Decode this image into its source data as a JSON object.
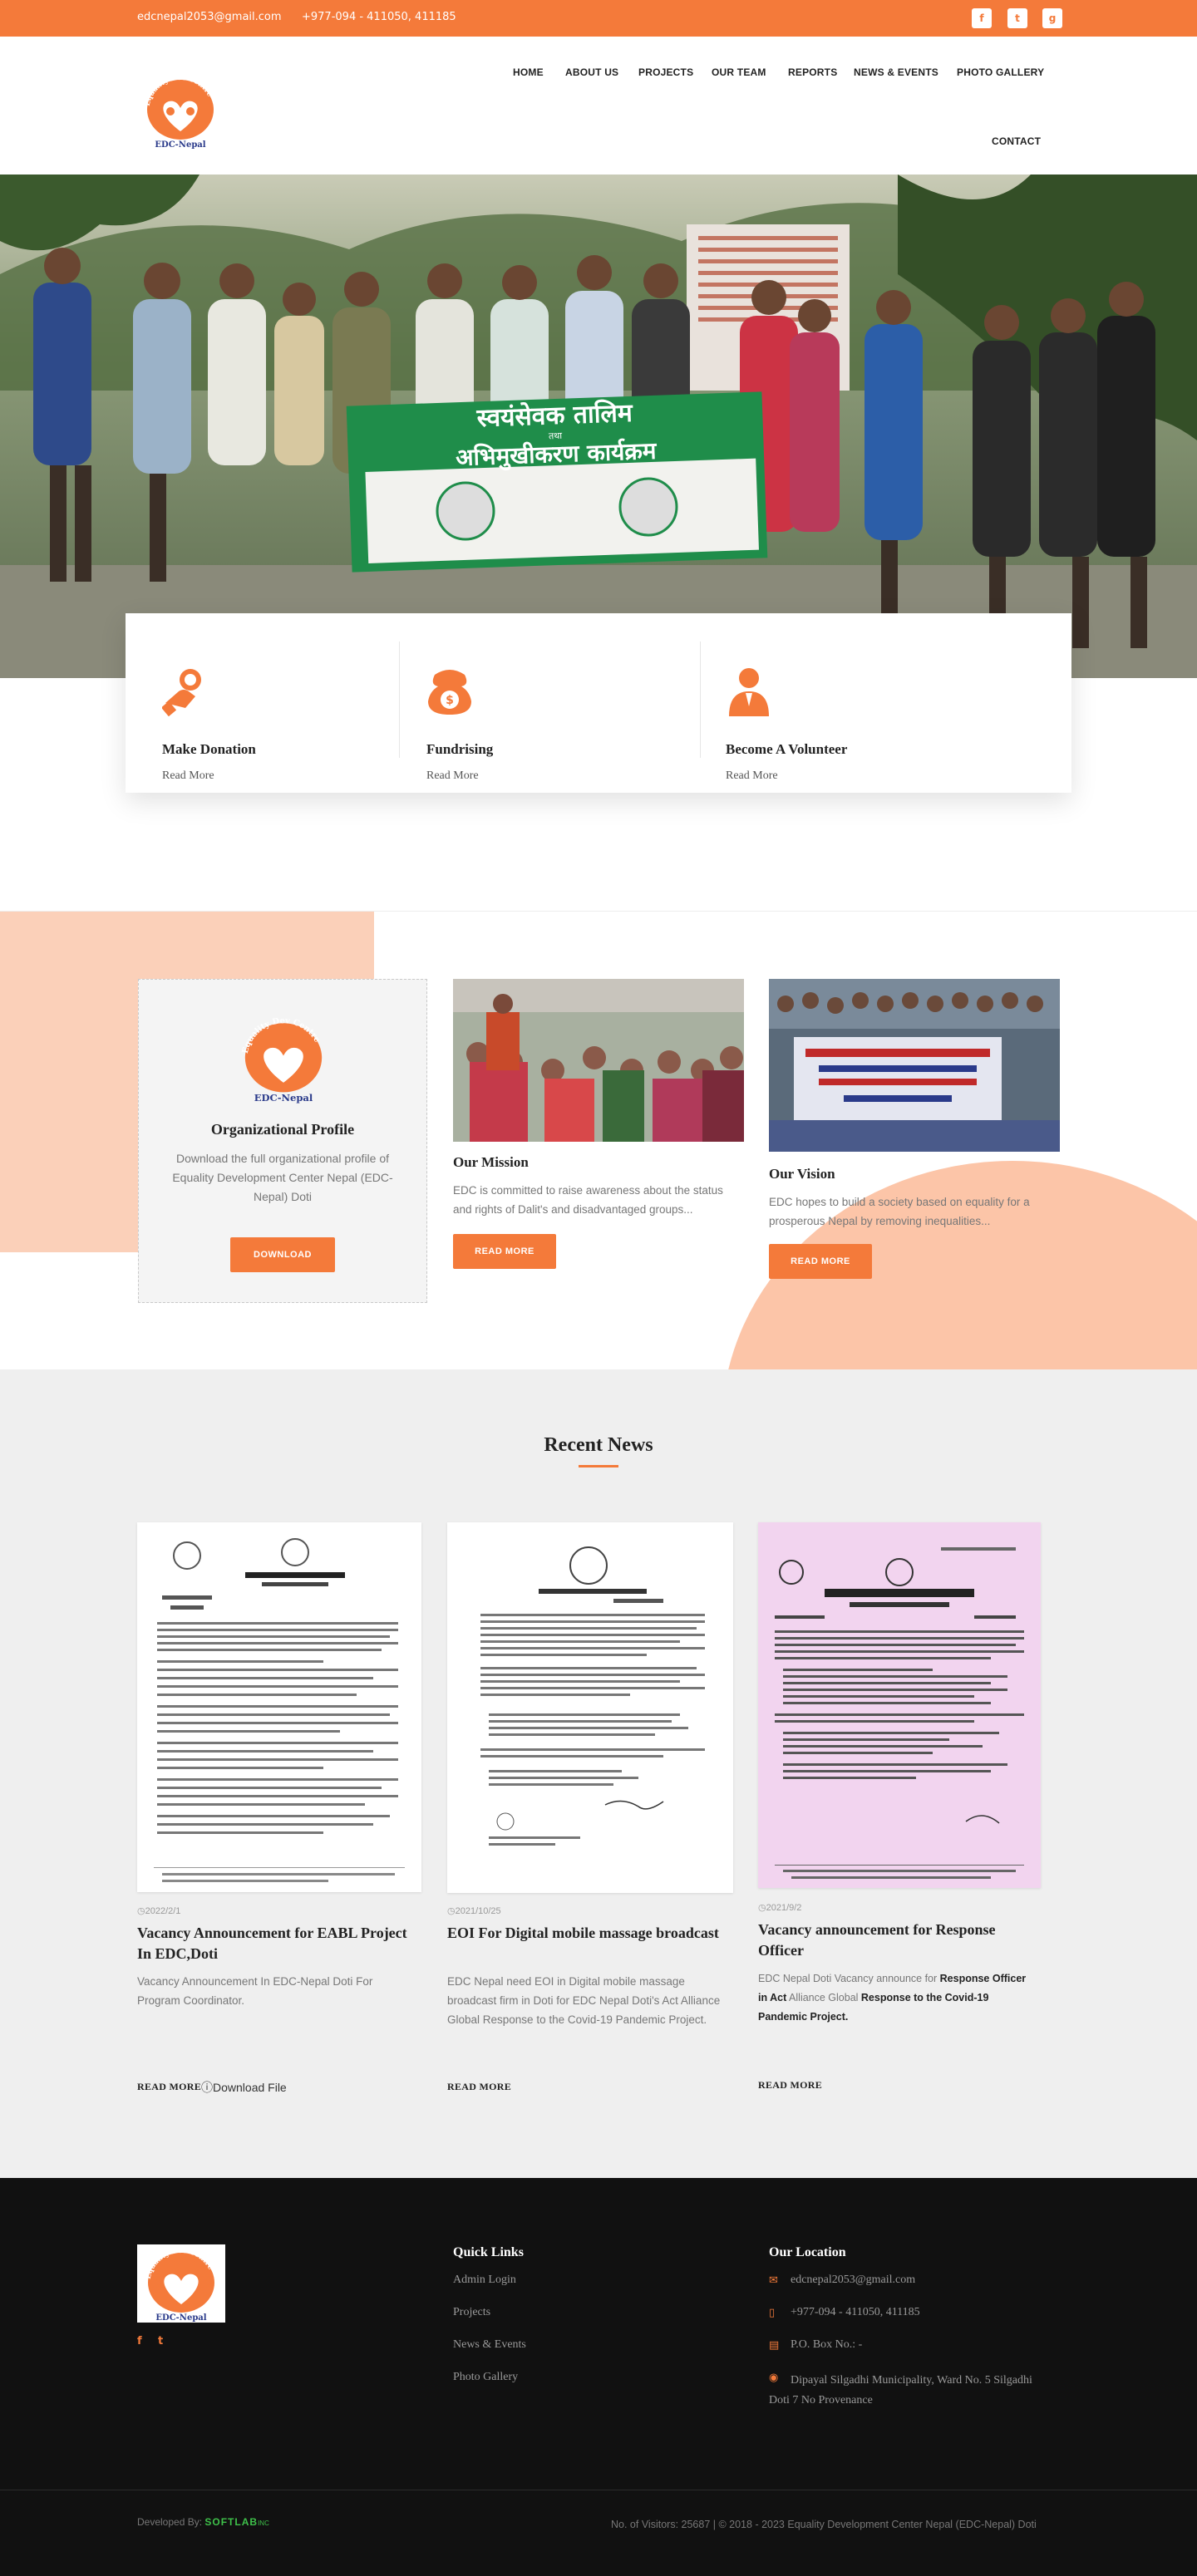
{
  "topbar": {
    "email": "edcnepal2053@gmail.com",
    "phone": "+977-094 - 411050, 411185",
    "social": [
      "f",
      "t",
      "g"
    ]
  },
  "logo": {
    "arc": "Equality Dev Centre",
    "text": "EDC-Nepal"
  },
  "nav": [
    "HOME",
    "ABOUT US",
    "PROJECTS",
    "OUR TEAM",
    "REPORTS",
    "NEWS & EVENTS",
    "PHOTO GALLERY",
    "CONTACT"
  ],
  "hero": {
    "banner_line1": "स्वयंसेवक तालिम",
    "banner_line2": "तथा",
    "banner_line3": "अभिमुखीकरण कार्यक्रम"
  },
  "actions": [
    {
      "title": "Make Donation",
      "link": "Read More",
      "icon": "hand-coin-icon"
    },
    {
      "title": "Fundrising",
      "link": "Read More",
      "icon": "money-bag-icon"
    },
    {
      "title": "Become A Volunteer",
      "link": "Read More",
      "icon": "person-icon"
    }
  ],
  "about": {
    "profile": {
      "title": "Organizational Profile",
      "text": "Download the full organizational profile of Equality Development Center Nepal (EDC-Nepal) Doti",
      "button": "DOWNLOAD"
    },
    "mission": {
      "title": "Our Mission",
      "text": "EDC is committed to raise awareness about the status and rights of Dalit's and disadvantaged groups...",
      "button": "READ MORE"
    },
    "vision": {
      "title": "Our Vision",
      "text": "EDC hopes to build a society based on equality for a prosperous Nepal by removing inequalities...",
      "button": "READ MORE"
    }
  },
  "news": {
    "heading": "Recent News",
    "items": [
      {
        "date": "2022/2/1",
        "title": "Vacancy Announcement for EABL Project In EDC,Doti",
        "text": "Vacancy Announcement In EDC-Nepal Doti For Program Coordinator.",
        "more": "READ MORE",
        "extra": "Download File"
      },
      {
        "date": "2021/10/25",
        "title": "EOI For Digital mobile massage broadcast",
        "text": "EDC Nepal need EOI in Digital mobile massage broadcast firm in Doti for EDC Nepal Doti's Act Alliance Global Response to the Covid-19 Pandemic Project.",
        "more": "READ MORE"
      },
      {
        "date": "2021/9/2",
        "title": "Vacancy announcement for Response Officer",
        "text_a": "EDC Nepal Doti Vacancy announce for ",
        "text_b": "Response Officer in Act",
        "text_c": " Alliance Global ",
        "text_d": "Response to the Covid-19 Pandemic Project.",
        "more": "READ MORE"
      }
    ]
  },
  "footer": {
    "quick_title": "Quick Links",
    "links": [
      "Admin Login",
      "Projects",
      "News & Events",
      "Photo Gallery"
    ],
    "loc_title": "Our Location",
    "email": "edcnepal2053@gmail.com",
    "phone": "+977-094 - 411050, 411185",
    "pobox": "P.O. Box No.: -",
    "address": "Dipayal Silgadhi Municipality, Ward No. 5 Silgadhi Doti 7 No Provenance",
    "dev": "Developed By: ",
    "dev_brand": "SOFTLAB",
    "dev_sub": "INC",
    "copyright": "No. of Visitors: 25687 | © 2018 - 2023 Equality Development Center Nepal (EDC-Nepal) Doti"
  },
  "colors": {
    "accent": "#f47a3a",
    "peach": "#fbd0b9",
    "footer": "#111111",
    "news_bg": "#efefef"
  }
}
